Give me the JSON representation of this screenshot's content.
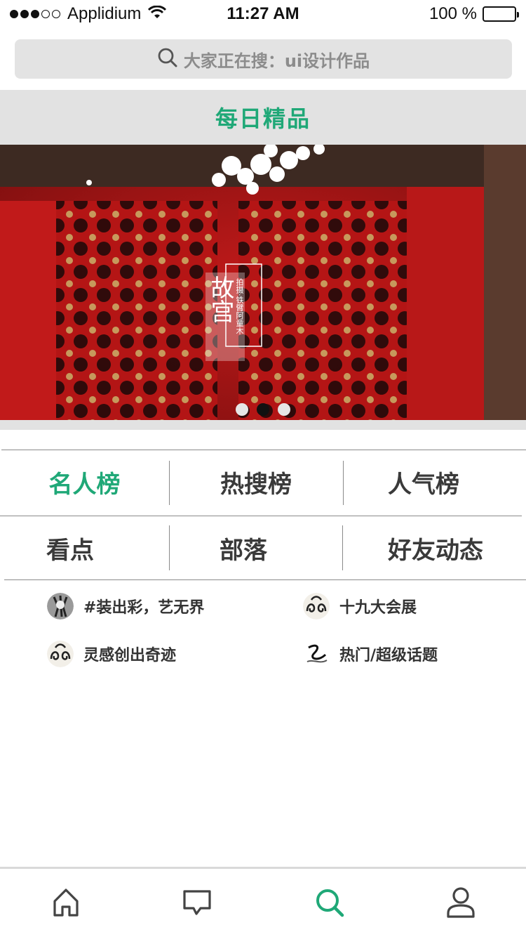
{
  "status_bar": {
    "carrier": "Applidium",
    "time": "11:27 AM",
    "battery": "100 %",
    "signal_icon": "signal-dots-icon",
    "wifi_icon": "wifi-icon",
    "battery_icon": "battery-icon"
  },
  "search": {
    "placeholder": "大家正在搜：ui设计作品",
    "icon": "search-icon"
  },
  "section": {
    "title": "每日精品"
  },
  "banner": {
    "title_big": "故宫",
    "caption": "拍摄·铁臂阿童木",
    "slides": 3,
    "active_slide": 2,
    "colors": {
      "wall": "#a51616",
      "flowers": "#ffffff"
    }
  },
  "grid": {
    "row1": [
      "名人榜",
      "热搜榜",
      "人气榜"
    ],
    "row2": [
      "看点",
      "部落",
      "好友动态"
    ],
    "active": "名人榜"
  },
  "topics": [
    {
      "label": "#装出彩，艺无界",
      "icon": "zebra-avatar-icon"
    },
    {
      "label": "十九大会展",
      "icon": "pattern-avatar-icon"
    },
    {
      "label": "灵感创出奇迹",
      "icon": "pattern-avatar-icon"
    },
    {
      "label": "热门/超级话题",
      "icon": "ink-avatar-icon"
    }
  ],
  "tabbar": {
    "items": [
      "home-icon",
      "message-icon",
      "search-icon",
      "profile-icon"
    ],
    "active": "search-icon"
  },
  "colors": {
    "accent": "#1fa877",
    "header_bg": "#e2e2e2",
    "search_bg": "#e3e3e3",
    "text": "#333333"
  }
}
